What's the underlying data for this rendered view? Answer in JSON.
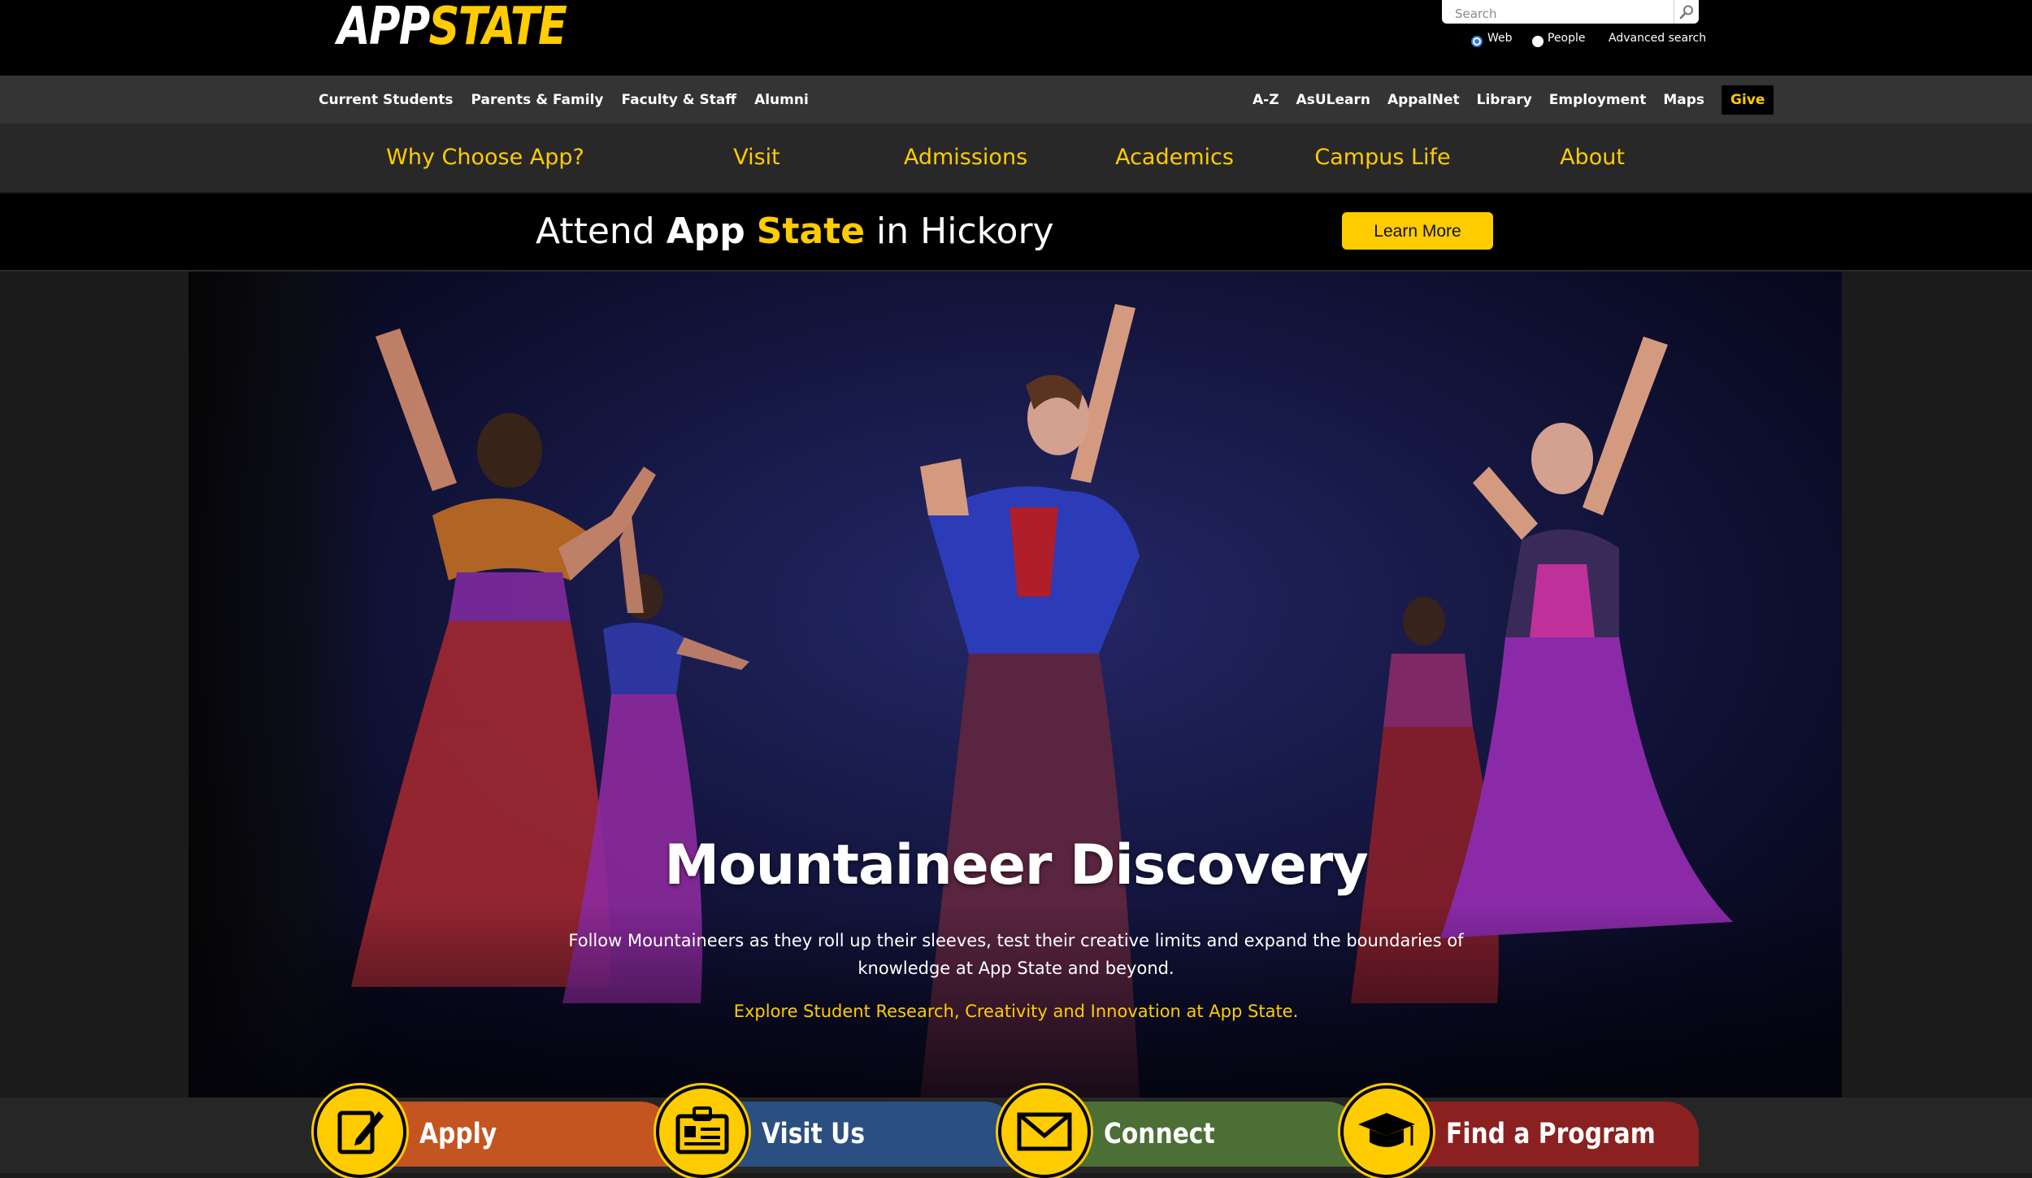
{
  "header": {
    "logo": {
      "part1": "APP",
      "part2": "STATE"
    },
    "search": {
      "placeholder": "Search"
    },
    "search_options": [
      {
        "label": "Web",
        "selected": true
      },
      {
        "label": "People",
        "selected": false
      }
    ],
    "advanced_search": "Advanced search"
  },
  "utility": {
    "left": [
      "Current Students",
      "Parents & Family",
      "Faculty & Staff",
      "Alumni"
    ],
    "right": [
      "A-Z",
      "AsULearn",
      "AppalNet",
      "Library",
      "Employment",
      "Maps"
    ],
    "give": "Give"
  },
  "nav": [
    "Why Choose App?",
    "Visit",
    "Admissions",
    "Academics",
    "Campus Life",
    "About"
  ],
  "banner": {
    "text_before": "Attend ",
    "text_app": "App",
    "text_state": "State",
    "text_after": " in Hickory",
    "button": "Learn More"
  },
  "hero": {
    "title": "Mountaineer Discovery",
    "description": "Follow Mountaineers as they roll up their sleeves, test their creative limits and expand the boundaries of knowledge at App State and beyond.",
    "link": "Explore Student Research, Creativity and Innovation at App State."
  },
  "actions": [
    {
      "label": "Apply",
      "icon": "pencil-paper-icon",
      "color": "#c45420"
    },
    {
      "label": "Visit Us",
      "icon": "id-card-icon",
      "color": "#2b4f80"
    },
    {
      "label": "Connect",
      "icon": "envelope-icon",
      "color": "#4c6f35"
    },
    {
      "label": "Find a Program",
      "icon": "graduation-cap-icon",
      "color": "#8a2120"
    }
  ],
  "colors": {
    "accent": "#ffcc00",
    "header": "#000000",
    "utility_bar": "#343434",
    "nav": "#282828"
  }
}
